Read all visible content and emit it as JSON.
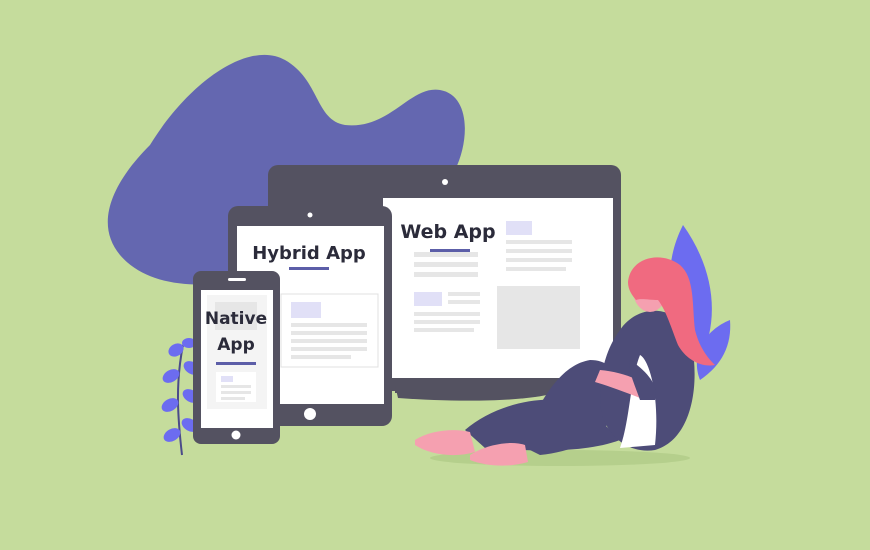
{
  "labels": {
    "web": "Web App",
    "hybrid": "Hybrid App",
    "native_line1": "Native",
    "native_line2": "App"
  },
  "colors": {
    "background": "#c5dc9c",
    "blob": "#6467b0",
    "device_frame": "#545261",
    "screen": "#ffffff",
    "placeholder": "#e6e6e6",
    "accent_bar": "#5c5ea8",
    "accent_light": "#e1e0f7",
    "hair": "#f06a80",
    "clothes": "#4d4c78",
    "shoes": "#f5a0b0",
    "leaf": "#6c6cf0"
  },
  "icons": [
    "blob-shape",
    "plant-icon",
    "leaf-icon",
    "person-illustration"
  ]
}
